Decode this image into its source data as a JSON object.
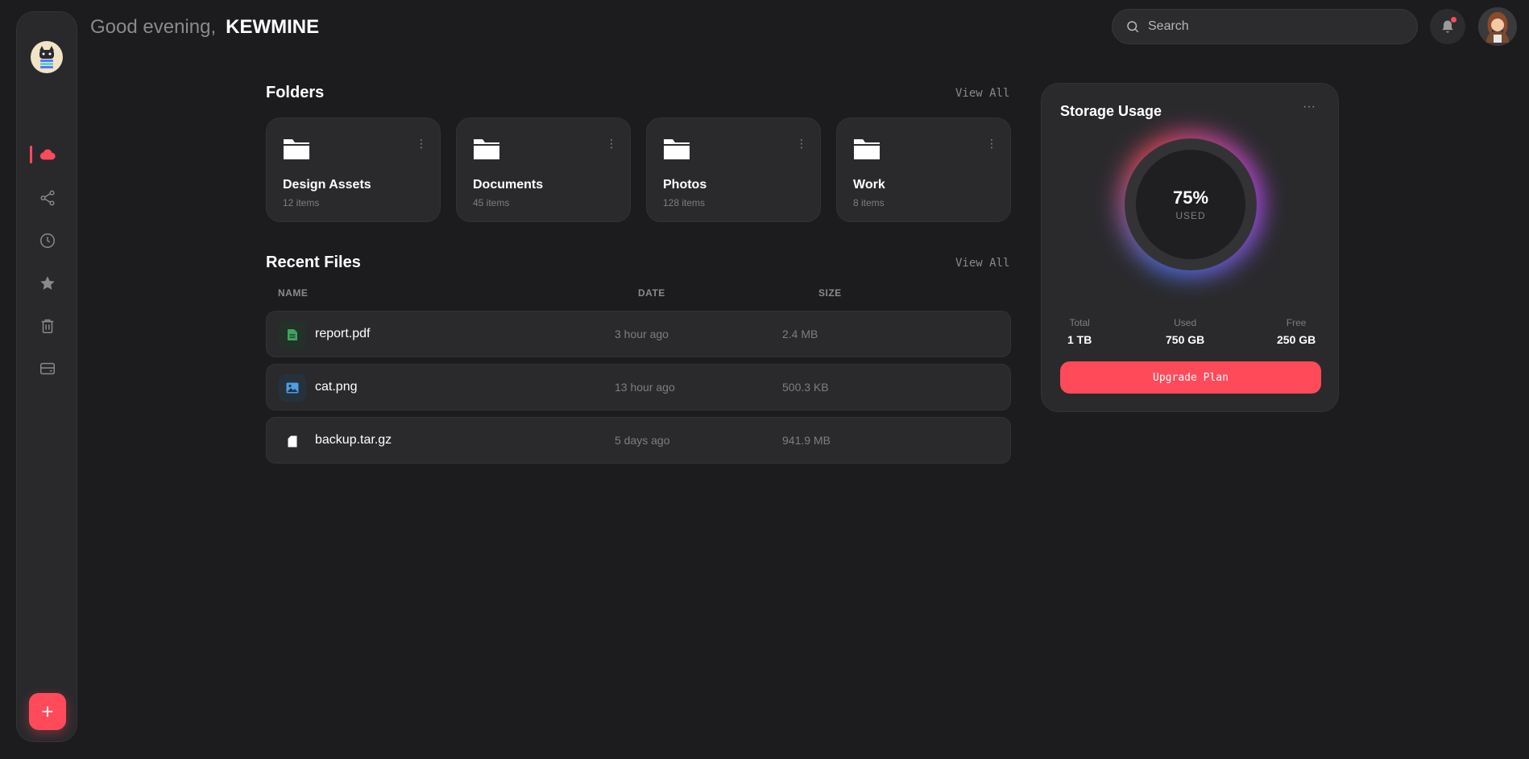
{
  "header": {
    "greeting": "Good evening,",
    "username": "KEWMINE",
    "search_placeholder": "Search"
  },
  "sidebar": {
    "items": [
      {
        "icon": "cloud-icon",
        "active": true
      },
      {
        "icon": "share-icon",
        "active": false
      },
      {
        "icon": "clock-icon",
        "active": false
      },
      {
        "icon": "star-icon",
        "active": false
      },
      {
        "icon": "trash-icon",
        "active": false
      },
      {
        "icon": "storage-icon",
        "active": false
      }
    ],
    "add_label": "+"
  },
  "folders": {
    "title": "Folders",
    "view_all": "View All",
    "items": [
      {
        "name": "Design Assets",
        "count": "12 items"
      },
      {
        "name": "Documents",
        "count": "45 items"
      },
      {
        "name": "Photos",
        "count": "128 items"
      },
      {
        "name": "Work",
        "count": "8 items"
      }
    ]
  },
  "recent": {
    "title": "Recent Files",
    "view_all": "View All",
    "columns": [
      "NAME",
      "DATE",
      "SIZE"
    ],
    "files": [
      {
        "name": "report.pdf",
        "date": "3 hour ago",
        "size": "2.4 MB",
        "icon": "document-icon"
      },
      {
        "name": "cat.png",
        "date": "13 hour ago",
        "size": "500.3 KB",
        "icon": "image-icon"
      },
      {
        "name": "backup.tar.gz",
        "date": "5 days ago",
        "size": "941.9 MB",
        "icon": "file-icon"
      }
    ]
  },
  "storage": {
    "title": "Storage Usage",
    "more": "···",
    "percent": "75%",
    "percent_label": "USED",
    "stats": [
      {
        "label": "Total",
        "value": "1 TB"
      },
      {
        "label": "Used",
        "value": "750 GB"
      },
      {
        "label": "Free",
        "value": "250 GB"
      }
    ],
    "upgrade_label": "Upgrade Plan"
  },
  "colors": {
    "accent": "#ff4a5a",
    "background": "#1c1c1e",
    "card": "#2a2a2d"
  }
}
